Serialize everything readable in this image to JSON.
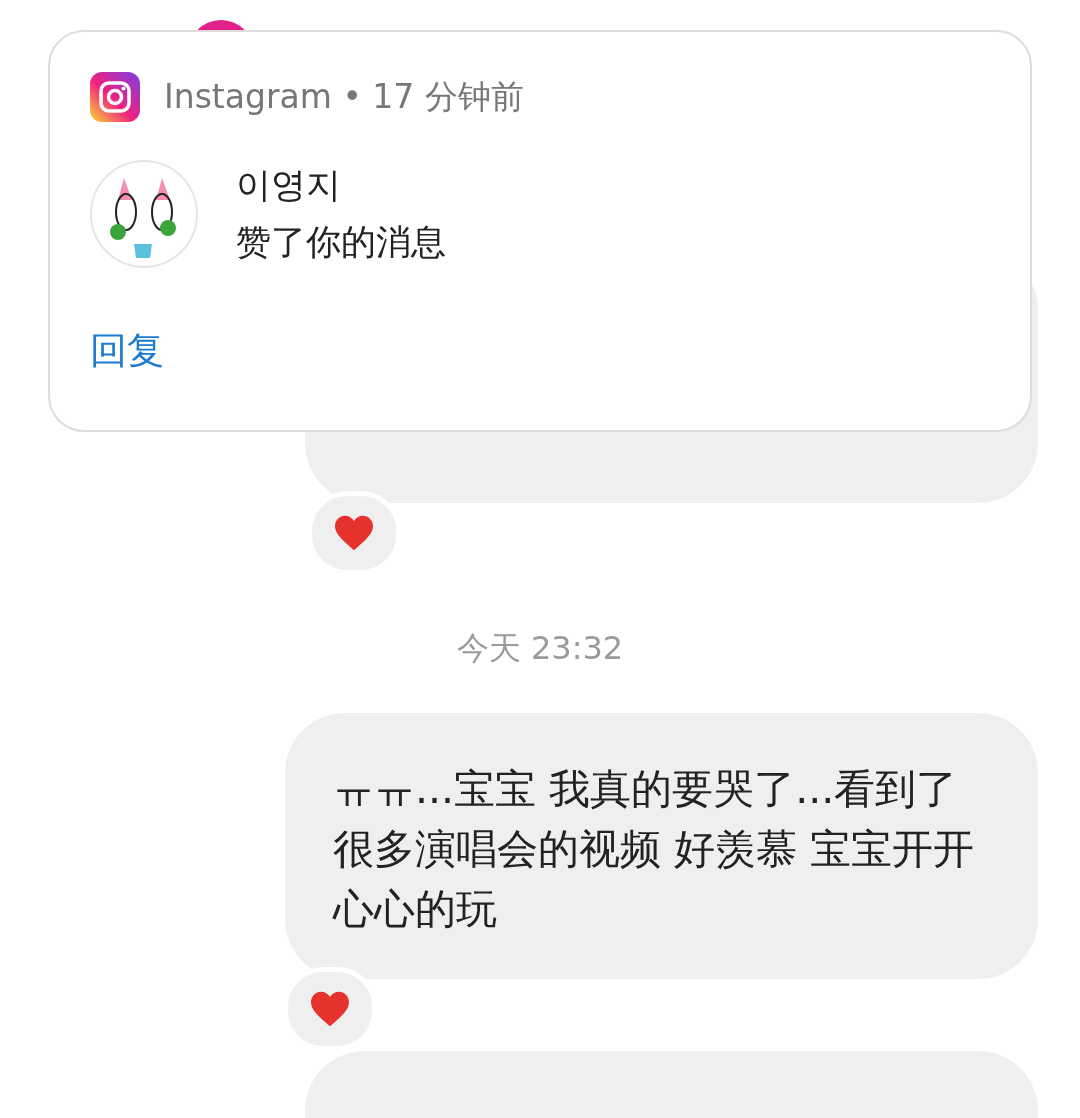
{
  "notification": {
    "app": "Instagram",
    "separator": "•",
    "time": "17 分钟前",
    "sender": "이영지",
    "message": "赞了你的消息",
    "action": "回复"
  },
  "chat": {
    "items": [
      {
        "kind": "message",
        "reacted": true
      },
      {
        "kind": "timestamp",
        "text": "今天 23:32"
      },
      {
        "kind": "message",
        "text": "ㅠㅠ...宝宝 我真的要哭了...看到了很多演唱会的视频 好羡慕 宝宝开开心心的玩",
        "reacted": true
      },
      {
        "kind": "message",
        "reacted": false
      }
    ]
  }
}
